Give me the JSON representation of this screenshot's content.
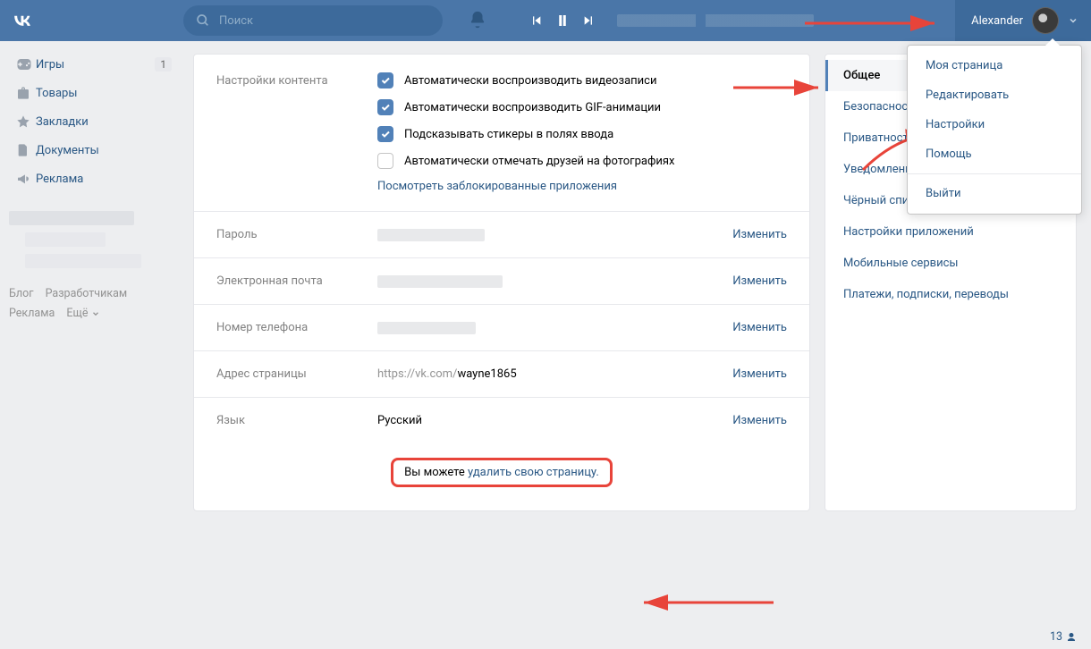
{
  "header": {
    "search_placeholder": "Поиск",
    "username": "Alexander"
  },
  "sidebar": {
    "items": [
      {
        "label": "Игры",
        "badge": "1"
      },
      {
        "label": "Товары"
      },
      {
        "label": "Закладки"
      },
      {
        "label": "Документы"
      },
      {
        "label": "Реклама"
      }
    ],
    "footer": {
      "blog": "Блог",
      "devs": "Разработчикам",
      "ads": "Реклама",
      "more": "Ещё"
    }
  },
  "settings": {
    "content_label": "Настройки контента",
    "options": [
      {
        "text": "Автоматически воспроизводить видеозаписи",
        "checked": true
      },
      {
        "text": "Автоматически воспроизводить GIF-анимации",
        "checked": true
      },
      {
        "text": "Подсказывать стикеры в полях ввода",
        "checked": true
      },
      {
        "text": "Автоматически отмечать друзей на фотографиях",
        "checked": false
      }
    ],
    "blocked_link": "Посмотреть заблокированные приложения",
    "rows": {
      "password": {
        "label": "Пароль",
        "action": "Изменить"
      },
      "email": {
        "label": "Электронная почта",
        "action": "Изменить"
      },
      "phone": {
        "label": "Номер телефона",
        "action": "Изменить"
      },
      "url": {
        "label": "Адрес страницы",
        "value": "https://vk.com/wayne1865",
        "action": "Изменить"
      },
      "lang": {
        "label": "Язык",
        "value": "Русский",
        "action": "Изменить"
      }
    },
    "delete": {
      "prefix": "Вы можете ",
      "link": "удалить свою страницу."
    }
  },
  "rightnav": [
    "Общее",
    "Безопасность",
    "Приватность",
    "Уведомления",
    "Чёрный список",
    "Настройки приложений",
    "Мобильные сервисы",
    "Платежи, подписки, переводы"
  ],
  "dropdown": [
    "Моя страница",
    "Редактировать",
    "Настройки",
    "Помощь",
    "Выйти"
  ],
  "counter": "13"
}
